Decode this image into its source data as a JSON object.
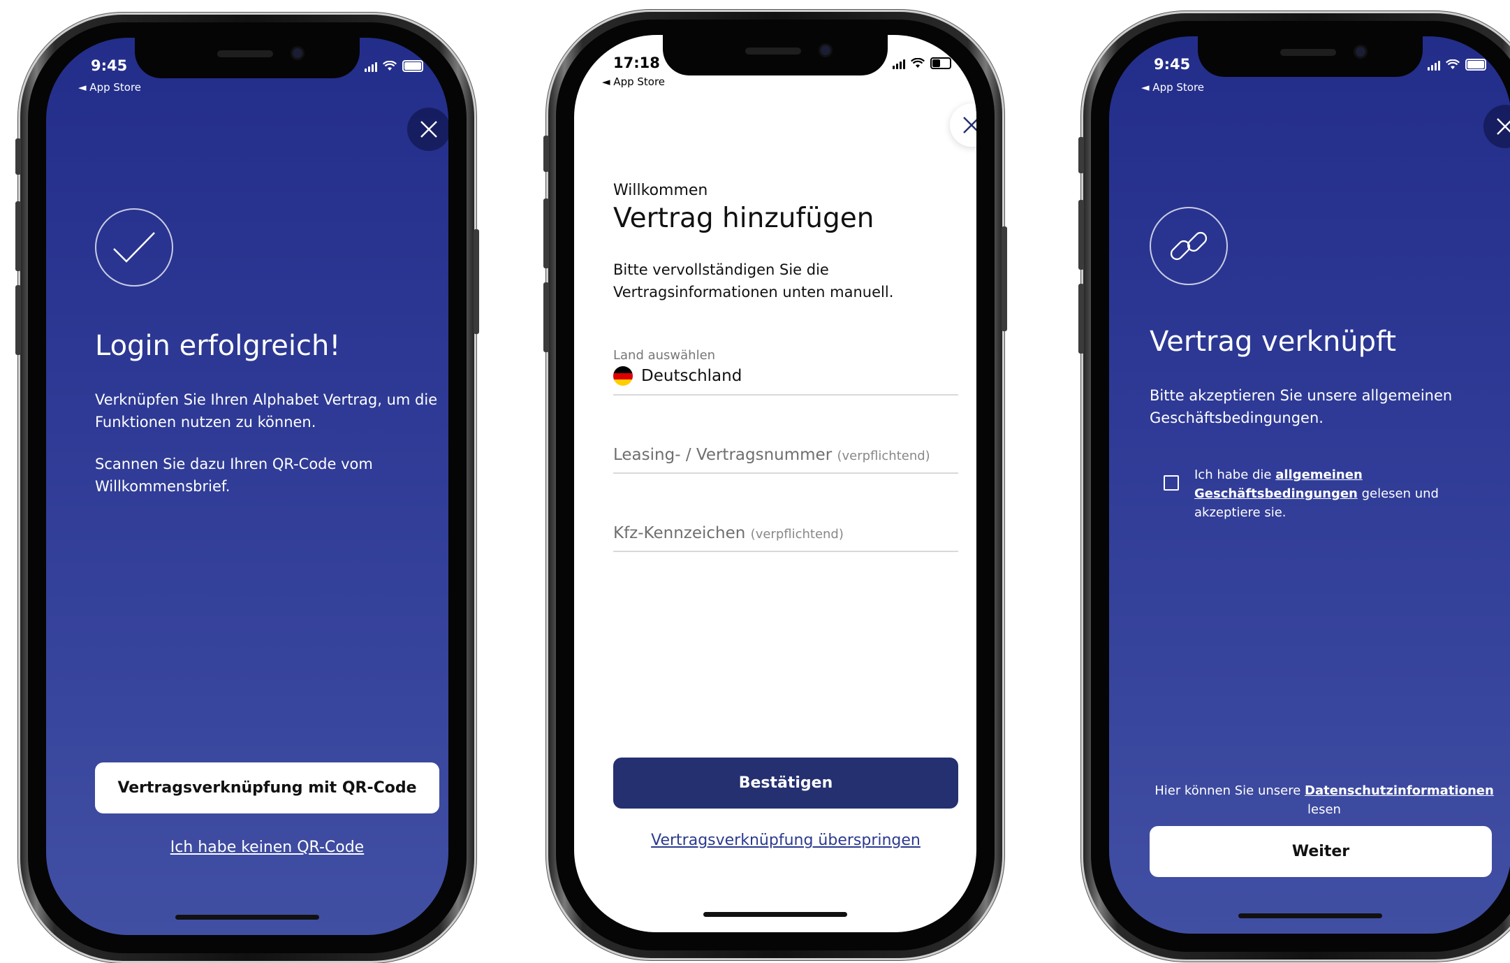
{
  "status_bar": [
    {
      "time": "9:45",
      "back": "◄ App Store"
    },
    {
      "time": "17:18",
      "back": "◄ App Store"
    },
    {
      "time": "9:45",
      "back": "◄ App Store"
    }
  ],
  "screen1": {
    "title": "Login erfolgreich!",
    "paragraph1": "Verknüpfen Sie Ihren Alphabet Vertrag, um die Funktionen nutzen zu können.",
    "paragraph2": "Scannen Sie dazu Ihren QR-Code vom Willkommensbrief.",
    "primary_button": "Vertragsverknüpfung mit QR-Code",
    "secondary_link": "Ich habe keinen QR-Code",
    "icon": "checkmark-icon"
  },
  "screen2": {
    "welcome": "Willkommen",
    "title": "Vertrag hinzufügen",
    "intro": "Bitte vervollständigen Sie die Vertragsinformationen unten manuell.",
    "country_label": "Land auswählen",
    "country_value": "Deutschland",
    "country_icon": "germany-flag-icon",
    "leasing_placeholder": "Leasing- / Vertragsnummer",
    "leasing_required": "(verpflichtend)",
    "plate_placeholder": "Kfz-Kennzeichen",
    "plate_required": "(verpflichtend)",
    "confirm_button": "Bestätigen",
    "skip_link": "Vertragsverknüpfung überspringen"
  },
  "screen3": {
    "title": "Vertrag verknüpft",
    "intro": "Bitte akzeptieren Sie unsere allgemeinen Geschäftsbedingungen.",
    "terms_prefix": "Ich habe die ",
    "terms_link": "allgemeinen Geschäftsbedingungen",
    "terms_suffix": " gelesen und akzeptiere sie.",
    "terms_checked": false,
    "privacy_prefix": "Hier können Sie unsere ",
    "privacy_link": "Datenschutzinformationen",
    "privacy_suffix": "lesen",
    "continue_button": "Weiter",
    "icon": "link-icon"
  },
  "colors": {
    "brand_blue": "#232d8a",
    "button_dark": "#243070",
    "link_blue": "#2b3a8f"
  }
}
